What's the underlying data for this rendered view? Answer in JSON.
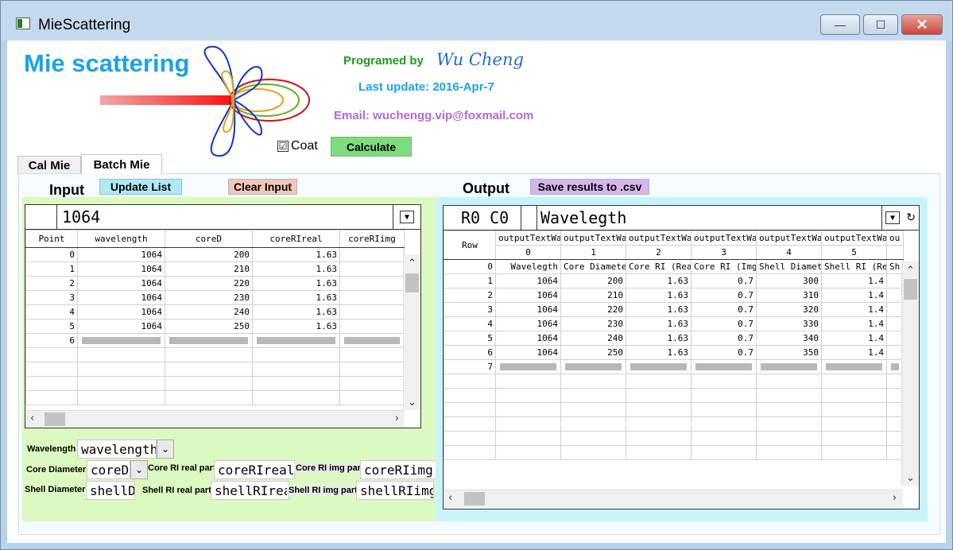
{
  "window": {
    "title": "MieScattering",
    "minimize": "—",
    "maximize": "☐",
    "close": "✕"
  },
  "header": {
    "title": "Mie scattering",
    "programmed_by": "Programed by",
    "author": "Wu Cheng",
    "last_update": "Last update: 2016-Apr-7",
    "email": "Email: wuchengg.vip@foxmail.com",
    "coat_label": "Coat",
    "coat_checked": "☑",
    "calculate": "Calculate"
  },
  "colors": {
    "accent_blue": "#1aa3e8",
    "green": "#1e9c1e",
    "purple": "#b06ad8",
    "calc_button": "#7ddc7d",
    "input_bg": "#dcf9c0",
    "output_bg": "#c8f4f9"
  },
  "tabs": [
    {
      "label": "Cal Mie"
    },
    {
      "label": "Batch Mie"
    }
  ],
  "input": {
    "label": "Input",
    "update_list": "Update List",
    "clear_input": "Clear Input",
    "cell_value": "1064",
    "columns": [
      "Point",
      "wavelength",
      "coreD",
      "coreRIreal",
      "coreRIimg"
    ],
    "rows": [
      [
        "0",
        "1064",
        "200",
        "1.63",
        ""
      ],
      [
        "1",
        "1064",
        "210",
        "1.63",
        ""
      ],
      [
        "2",
        "1064",
        "220",
        "1.63",
        ""
      ],
      [
        "3",
        "1064",
        "230",
        "1.63",
        ""
      ],
      [
        "4",
        "1064",
        "240",
        "1.63",
        ""
      ],
      [
        "5",
        "1064",
        "250",
        "1.63",
        ""
      ]
    ],
    "new_row": "6",
    "fields": {
      "wavelength_label": "Wavelength",
      "wavelength_value": "wavelength",
      "core_diameter_label": "Core Diameter",
      "core_diameter_value": "coreD",
      "core_ri_real_label": "Core RI real part",
      "core_ri_real_value": "coreRIreal",
      "core_ri_img_label": "Core RI img part",
      "core_ri_img_value": "coreRIimg",
      "shell_diameter_label": "Shell Diameter",
      "shell_diameter_value": "shellD",
      "shell_ri_real_label": "Shell RI real part",
      "shell_ri_real_value": "shellRIreal",
      "shell_ri_img_label": "Shell RI img part",
      "shell_ri_img_value": "shellRIimg"
    }
  },
  "output": {
    "label": "Output",
    "save_button": "Save results to .csv",
    "cell_ref": "R0 C0",
    "cell_value": "Wavelegth",
    "header1": [
      "Row",
      "outputTextWav",
      "outputTextWav",
      "outputTextWav",
      "outputTextWav",
      "outputTextWav",
      "outputTextWav",
      "ou"
    ],
    "header2": [
      "",
      "0",
      "1",
      "2",
      "3",
      "4",
      "5",
      ""
    ],
    "label_row": [
      "0",
      "Wavelegth",
      "Core Diameter",
      "Core RI (Real",
      "Core RI (Img",
      "Shell Diamete",
      "Shell RI (Re",
      "Sh"
    ],
    "rows": [
      [
        "1",
        "1064",
        "200",
        "1.63",
        "0.7",
        "300",
        "1.4"
      ],
      [
        "2",
        "1064",
        "210",
        "1.63",
        "0.7",
        "310",
        "1.4"
      ],
      [
        "3",
        "1064",
        "220",
        "1.63",
        "0.7",
        "320",
        "1.4"
      ],
      [
        "4",
        "1064",
        "230",
        "1.63",
        "0.7",
        "330",
        "1.4"
      ],
      [
        "5",
        "1064",
        "240",
        "1.63",
        "0.7",
        "340",
        "1.4"
      ],
      [
        "6",
        "1064",
        "250",
        "1.63",
        "0.7",
        "350",
        "1.4"
      ]
    ],
    "new_row": "7"
  }
}
